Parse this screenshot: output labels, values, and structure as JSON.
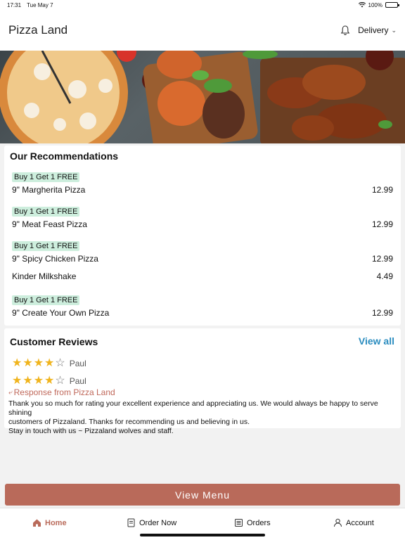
{
  "status_bar": {
    "time": "17:31",
    "date": "Tue May 7",
    "battery": "100%",
    "battery_level": 1.0
  },
  "header": {
    "title": "Pizza Land",
    "delivery_label": "Delivery",
    "icons": [
      "bell-icon",
      "chevron-down-icon"
    ]
  },
  "recommendations": {
    "title": "Our Recommendations",
    "items": [
      {
        "badge": "Buy 1 Get 1 FREE",
        "name": "9\" Margherita Pizza",
        "price": "12.99"
      },
      {
        "badge": "Buy 1 Get 1 FREE",
        "name": "9\" Meat Feast Pizza",
        "price": "12.99"
      },
      {
        "badge": "Buy 1 Get 1 FREE",
        "name": "9\" Spicy Chicken Pizza",
        "price": "12.99"
      },
      {
        "badge": "",
        "name": "Kinder Milkshake",
        "price": "4.49"
      },
      {
        "badge": "Buy 1 Get 1 FREE",
        "name": "9\" Create Your Own Pizza",
        "price": "12.99"
      }
    ]
  },
  "reviews": {
    "title": "Customer Reviews",
    "view_all": "View all",
    "items": [
      {
        "rating": 4,
        "max_rating": 5,
        "name": "Paul"
      },
      {
        "rating": 4,
        "max_rating": 5,
        "name": "Paul"
      }
    ],
    "response_label": "Response from Pizza Land",
    "response_text_lines": [
      "Thank you so much for rating your excellent experience and appreciating us. We would always be happy to serve shining",
      "customers of Pizzaland. Thanks for recommending us and believing in us.",
      "Stay in touch with us ~ Pizzaland wolves and staff."
    ]
  },
  "view_menu_label": "View Menu",
  "tabs": [
    {
      "label": "Home",
      "icon": "home-icon",
      "active": true
    },
    {
      "label": "Order Now",
      "icon": "order-icon",
      "active": false
    },
    {
      "label": "Orders",
      "icon": "list-icon",
      "active": false
    },
    {
      "label": "Account",
      "icon": "user-icon",
      "active": false
    }
  ],
  "colors": {
    "accent": "#b96a5a",
    "badge_bg": "#cdeedd",
    "link": "#2a8cbf",
    "star": "#f0b41d"
  }
}
